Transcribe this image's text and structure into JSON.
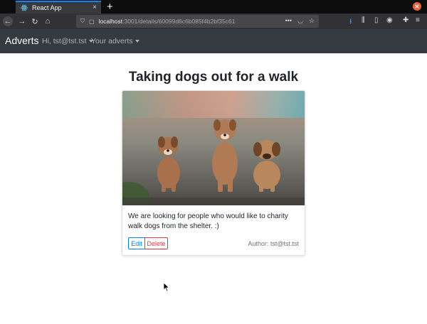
{
  "browser": {
    "tab_title": "React App",
    "tab_close": "×",
    "new_tab": "+",
    "url_host": "localhost",
    "url_rest": ":3001/details/60099d6c6b085f4b2bf35c61",
    "url_more": "•••"
  },
  "nav": {
    "brand": "Adverts",
    "user_menu": "Hi, tst@tst.tst",
    "adverts_menu": "Your adverts"
  },
  "advert": {
    "title": "Taking dogs out for a walk",
    "description": "We are looking for people who would like to charity walk dogs from the shelter. :)",
    "edit_label": "Edit",
    "delete_label": "Delete",
    "author": "Author: tst@tst.tst"
  },
  "colors": {
    "navbar": "#343a40",
    "primary": "#007bff",
    "danger": "#dc3545",
    "muted": "#6c757d"
  }
}
